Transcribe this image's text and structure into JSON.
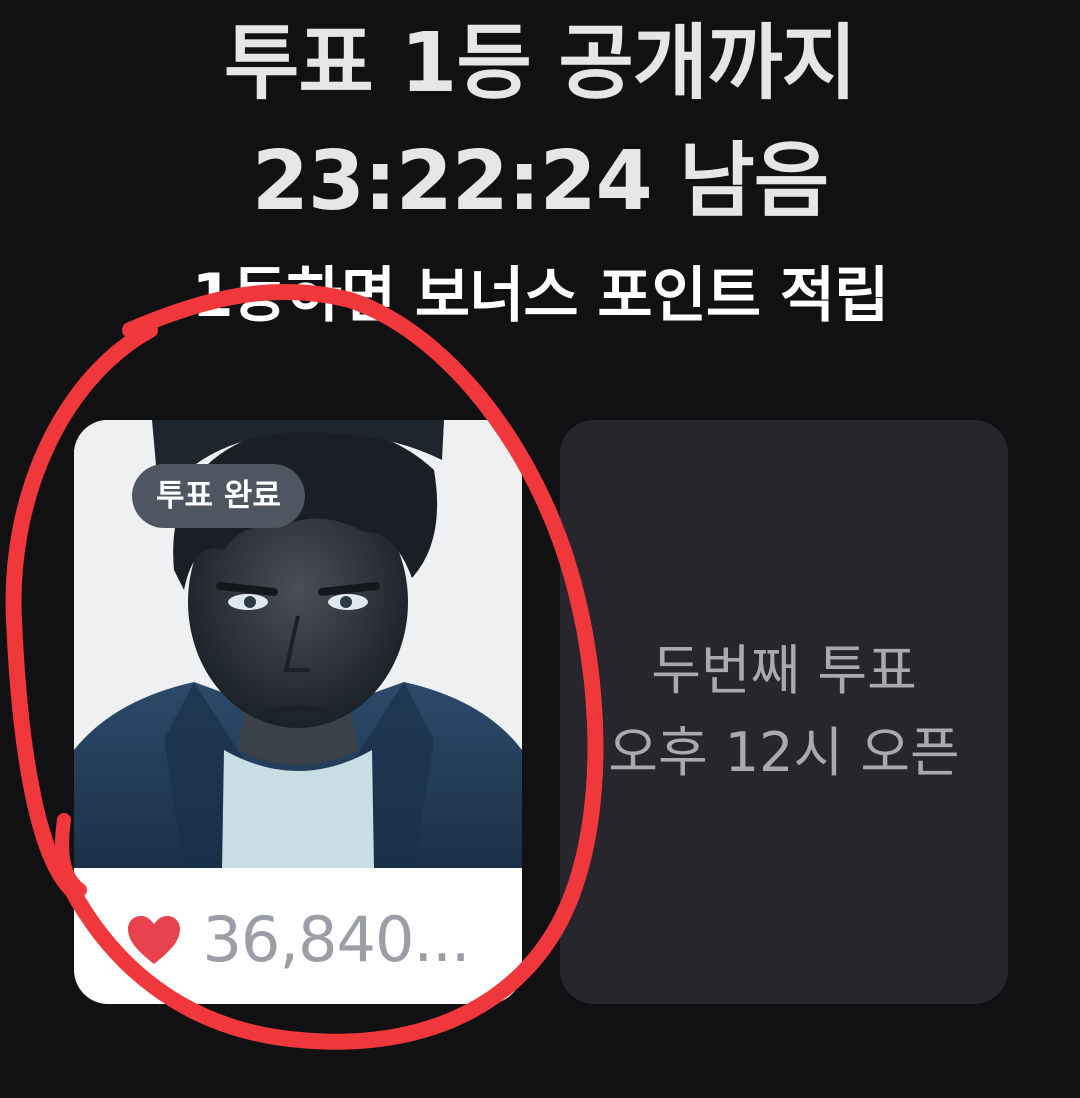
{
  "header": {
    "line1": "투표 1등 공개까지",
    "line2": "23:22:24 남음",
    "line3": "1등하면 보너스 포인트 적립"
  },
  "vote_card": {
    "badge": "투표 완료",
    "vote_count": "36,840...",
    "icon": "heart-icon"
  },
  "next_vote_card": {
    "line1": "두번째 투표",
    "line2": "오후 12시 오픈"
  },
  "colors": {
    "background": "#111113",
    "heart": "#e8424e",
    "annotation": "#f0383c",
    "badge_bg": "#4e5661",
    "next_card_bg": "#26262c"
  }
}
